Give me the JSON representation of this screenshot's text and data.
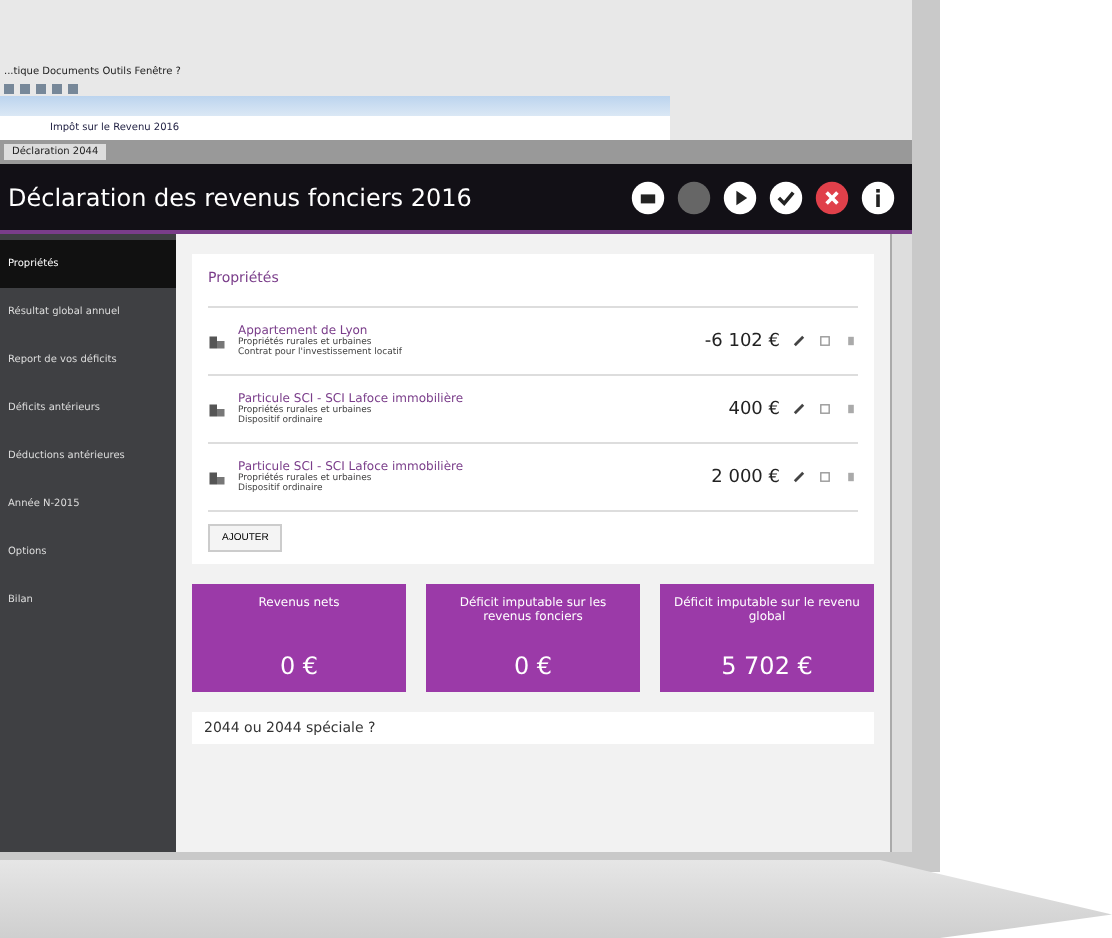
{
  "host_app": {
    "menu": "...tique  Documents  Outils  Fenêtre  ?",
    "inner_window_title": "Impôt sur le Revenu 2016",
    "tab": "Déclaration 2044"
  },
  "header": {
    "title": "Déclaration des revenus fonciers 2016"
  },
  "sidebar": {
    "items": [
      {
        "label": "Propriétés",
        "selected": true
      },
      {
        "label": "Résultat global annuel",
        "selected": false
      },
      {
        "label": "Report de vos déficits",
        "selected": false
      },
      {
        "label": "Déficits antérieurs",
        "selected": false
      },
      {
        "label": "Déductions antérieures",
        "selected": false
      },
      {
        "label": "Année N-2015",
        "selected": false
      },
      {
        "label": "Options",
        "selected": false
      },
      {
        "label": "Bilan",
        "selected": false
      }
    ]
  },
  "properties": {
    "title": "Propriétés",
    "rows": [
      {
        "name": "Appartement de Lyon",
        "line1": "Propriétés rurales et urbaines",
        "line2": "Contrat pour l'investissement locatif",
        "amount": "-6 102 €"
      },
      {
        "name": "Particule SCI - SCI Lafoce immobilière",
        "line1": "Propriétés rurales et urbaines",
        "line2": "Dispositif ordinaire",
        "amount": "400 €"
      },
      {
        "name": "Particule SCI - SCI Lafoce immobilière",
        "line1": "Propriétés rurales et urbaines",
        "line2": "Dispositif ordinaire",
        "amount": "2 000 €"
      }
    ],
    "add_button": "AJOUTER"
  },
  "summary_cards": [
    {
      "label": "Revenus nets",
      "value": "0 €"
    },
    {
      "label": "Déficit imputable sur les revenus fonciers",
      "value": "0 €"
    },
    {
      "label": "Déficit imputable sur le revenu global",
      "value": "5 702 €"
    }
  ],
  "footer_question": "2044 ou 2044 spéciale ?"
}
